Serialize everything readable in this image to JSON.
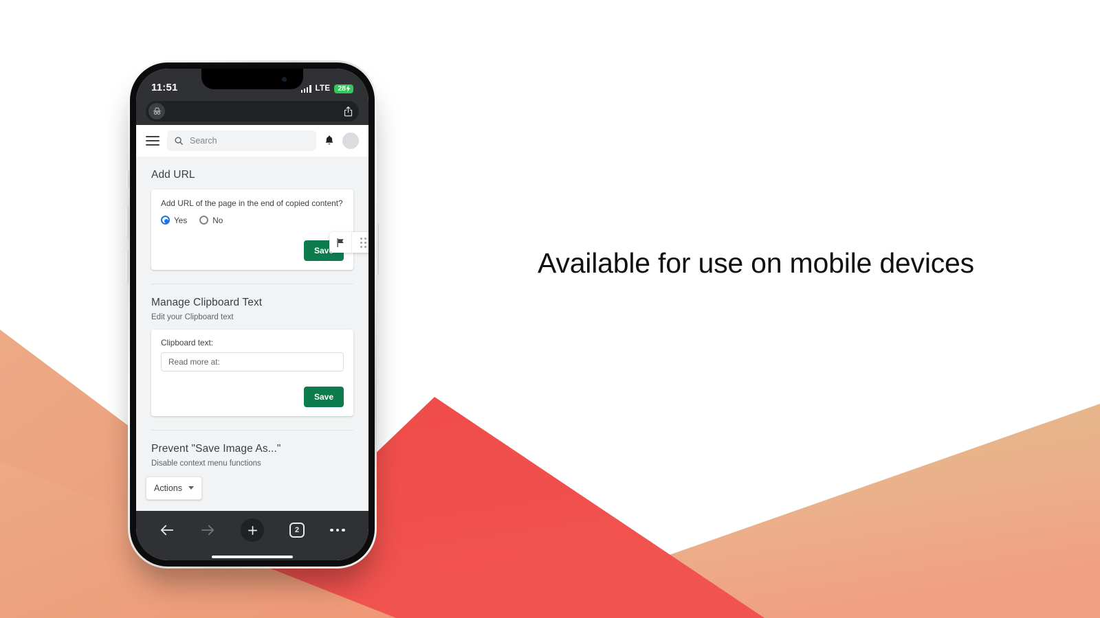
{
  "headline": "Available for use on mobile devices",
  "palette": {
    "salmon_light": "#eda27d",
    "salmon_dark": "#f4735f",
    "red": "#ef4b49",
    "tan_light": "#e6bd8c",
    "tan_dark": "#f0a183",
    "white": "#ffffff",
    "save_green": "#0c7b4d",
    "radio_blue": "#1a73e8",
    "battery_green": "#34c759",
    "phone_dark": "#303134",
    "page_bg": "#f1f3f4"
  },
  "phone": {
    "status_bar": {
      "clock": "11:51",
      "network": "LTE",
      "battery_level": "28",
      "battery_charging_glyph": "⚡",
      "signal_icon": "signal-bars-icon"
    },
    "browser": {
      "incognito_icon": "incognito-icon",
      "share_icon": "share-icon",
      "bottom_nav": {
        "back_icon": "arrow-left-icon",
        "forward_icon": "arrow-right-icon",
        "new_tab_icon": "plus-icon",
        "tab_count": "2",
        "menu_icon": "more-horizontal-icon"
      }
    },
    "app_header": {
      "menu_icon": "hamburger-menu-icon",
      "search_placeholder": "Search",
      "search_icon": "search-icon",
      "notifications_icon": "bell-icon",
      "avatar": "avatar"
    },
    "floating_widget": {
      "flag_icon": "flag-icon",
      "drag_handle_icon": "drag-handle-icon"
    },
    "sections": [
      {
        "title": "Add URL",
        "question": "Add URL of the page in the end of copied content?",
        "options": [
          {
            "label": "Yes",
            "selected": true
          },
          {
            "label": "No",
            "selected": false
          }
        ],
        "save_label": "Save"
      },
      {
        "title": "Manage Clipboard Text",
        "subtitle": "Edit your Clipboard text",
        "field_label": "Clipboard text:",
        "field_value": "",
        "field_placeholder": "Read more at:",
        "save_label": "Save"
      },
      {
        "title": "Prevent \"Save Image As...\"",
        "subtitle": "Disable context menu functions",
        "actions_label": "Actions"
      }
    ]
  }
}
